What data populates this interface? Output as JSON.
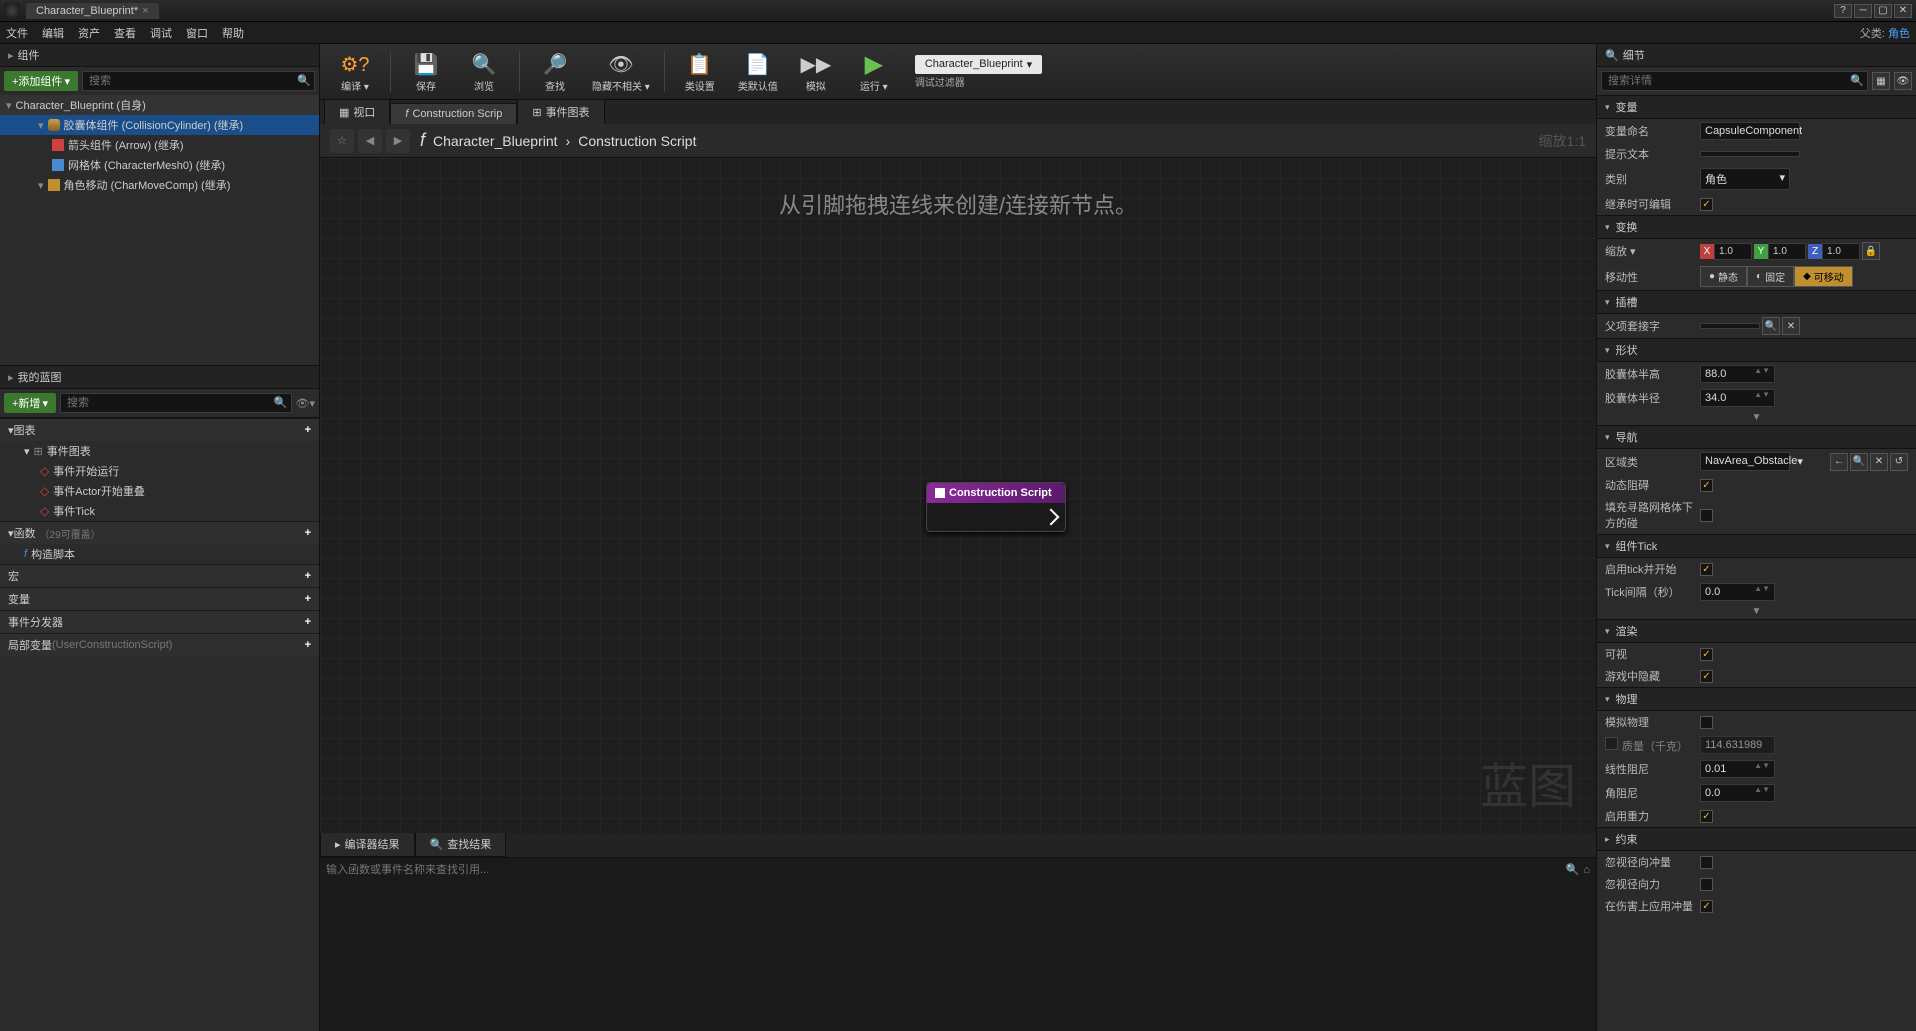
{
  "titlebar": {
    "tab": "Character_Blueprint*"
  },
  "menu": {
    "file": "文件",
    "edit": "编辑",
    "asset": "资产",
    "view": "查看",
    "debug": "调试",
    "window": "窗口",
    "help": "帮助",
    "parent_label": "父类:",
    "parent_class": "角色"
  },
  "components": {
    "header": "组件",
    "add": "+添加组件",
    "search_ph": "搜索",
    "root": "Character_Blueprint (自身)",
    "items": [
      {
        "label": "胶囊体组件 (CollisionCylinder) (继承)",
        "icon": "capsule",
        "selected": true,
        "indent": 0
      },
      {
        "label": "箭头组件 (Arrow) (继承)",
        "icon": "arrow",
        "indent": 1
      },
      {
        "label": "网格体 (CharacterMesh0) (继承)",
        "icon": "mesh",
        "indent": 1
      },
      {
        "label": "角色移动 (CharMoveComp) (继承)",
        "icon": "move",
        "indent": 0
      }
    ]
  },
  "myblueprint": {
    "header": "我的蓝图",
    "add": "+新增",
    "search_ph": "搜索",
    "graphs_label": "图表",
    "event_graph_label": "事件图表",
    "events": [
      "事件开始运行",
      "事件Actor开始重叠",
      "事件Tick"
    ],
    "functions_label": "函数",
    "functions_suffix": "（29可覆盖）",
    "functions": [
      "构造脚本"
    ],
    "macros_label": "宏",
    "vars_label": "变量",
    "dispatchers_label": "事件分发器",
    "local_vars_label": "局部变量",
    "local_vars_ctx": "(UserConstructionScript)"
  },
  "toolbar": {
    "compile": "编译",
    "save": "保存",
    "browse": "浏览",
    "find": "查找",
    "hide": "隐藏不相关",
    "class_settings": "类设置",
    "class_defaults": "类默认值",
    "simulate": "模拟",
    "play": "运行",
    "bp_dropdown": "Character_Blueprint",
    "debug_filter": "调试过滤器"
  },
  "graph_tabs": {
    "viewport": "视口",
    "construction": "Construction Scrip",
    "event": "事件图表"
  },
  "breadcrumb": {
    "bp": "Character_Blueprint",
    "sep": "›",
    "cs": "Construction Script",
    "zoom": "缩放1:1"
  },
  "graph": {
    "hint": "从引脚拖拽连线来创建/连接新节点。",
    "watermark": "蓝图",
    "node_title": "Construction Script"
  },
  "bottom": {
    "compiler": "编译器结果",
    "find": "查找结果",
    "find_ph": "输入函数或事件名称来查找引用..."
  },
  "details": {
    "header": "细节",
    "search_ph": "搜索详情",
    "variable_section": "变量",
    "var_name_label": "变量命名",
    "var_name": "CapsuleComponent",
    "tooltip_label": "提示文本",
    "tooltip": "",
    "category_label": "类别",
    "category": "角色",
    "editable_label": "继承时可编辑",
    "editable": true,
    "transform_section": "变换",
    "scale_label": "缩放",
    "scale": {
      "x": "1.0",
      "y": "1.0",
      "z": "1.0"
    },
    "mobility_label": "移动性",
    "mob_static": "静态",
    "mob_stationary": "固定",
    "mob_movable": "可移动",
    "socket_section": "插槽",
    "parent_socket_label": "父项套接字",
    "parent_socket": "",
    "shape_section": "形状",
    "half_height_label": "胶囊体半高",
    "half_height": "88.0",
    "radius_label": "胶囊体半径",
    "radius": "34.0",
    "nav_section": "导航",
    "area_class_label": "区域类",
    "area_class": "NavArea_Obstacle",
    "dynamic_obstacle_label": "动态阻碍",
    "dynamic_obstacle": true,
    "fill_nav_label": "填充寻路网格体下方的碰",
    "fill_nav": false,
    "tick_section": "组件Tick",
    "start_tick_label": "启用tick并开始",
    "start_tick": true,
    "tick_interval_label": "Tick间隔（秒）",
    "tick_interval": "0.0",
    "render_section": "渲染",
    "visible_label": "可视",
    "visible": true,
    "hidden_label": "游戏中隐藏",
    "hidden": true,
    "physics_section": "物理",
    "simulate_label": "模拟物理",
    "simulate": false,
    "mass_label": "质量（千克）",
    "mass": "114.631989",
    "linear_damp_label": "线性阻尼",
    "linear_damp": "0.01",
    "angular_damp_label": "角阻尼",
    "angular_damp": "0.0",
    "gravity_label": "启用重力",
    "gravity": true,
    "constraints_section": "约束",
    "ignore_radial_impulse_label": "忽视径向冲量",
    "ignore_radial_impulse": false,
    "ignore_radial_force_label": "忽视径向力",
    "ignore_radial_force": false,
    "apply_impulse_damage_label": "在伤害上应用冲量",
    "apply_impulse_damage": true
  }
}
